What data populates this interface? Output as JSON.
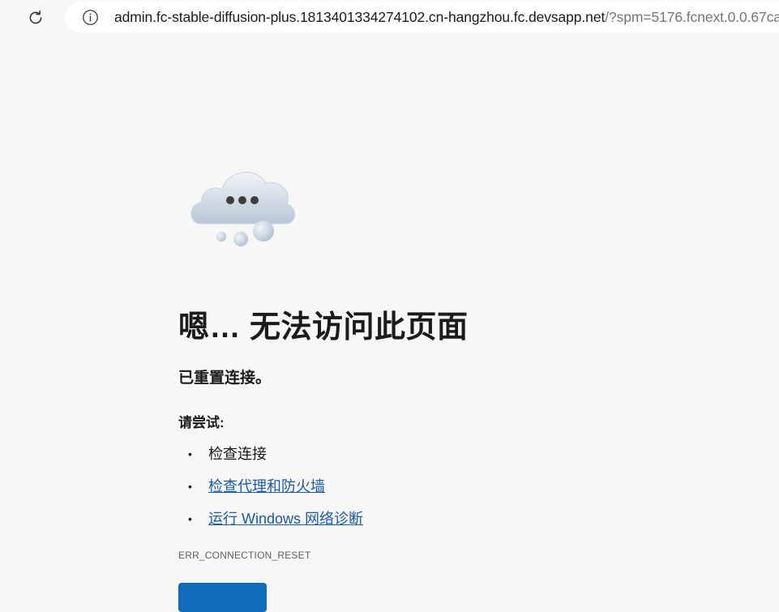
{
  "browser": {
    "url_host": "admin.fc-stable-diffusion-plus.1813401334274102.cn-hangzhou.fc.devsapp.net",
    "url_rest": "/?spm=5176.fcnext.0.0.67ca"
  },
  "page": {
    "heading": "嗯… 无法访问此页面",
    "subtitle": "已重置连接。",
    "try_label": "请尝试:",
    "suggestions": [
      {
        "label": "检查连接",
        "is_link": false
      },
      {
        "label": "检查代理和防火墙",
        "is_link": true
      },
      {
        "label": "运行 Windows 网络诊断",
        "is_link": true
      }
    ],
    "error_code": "ERR_CONNECTION_RESET"
  },
  "colors": {
    "background": "#f7f7f7",
    "link": "#1a5aa8",
    "primary_button": "#0f6cbd"
  },
  "icons": {
    "reload": "reload-icon",
    "info": "info-icon",
    "illustration": "cloud-illustration"
  }
}
